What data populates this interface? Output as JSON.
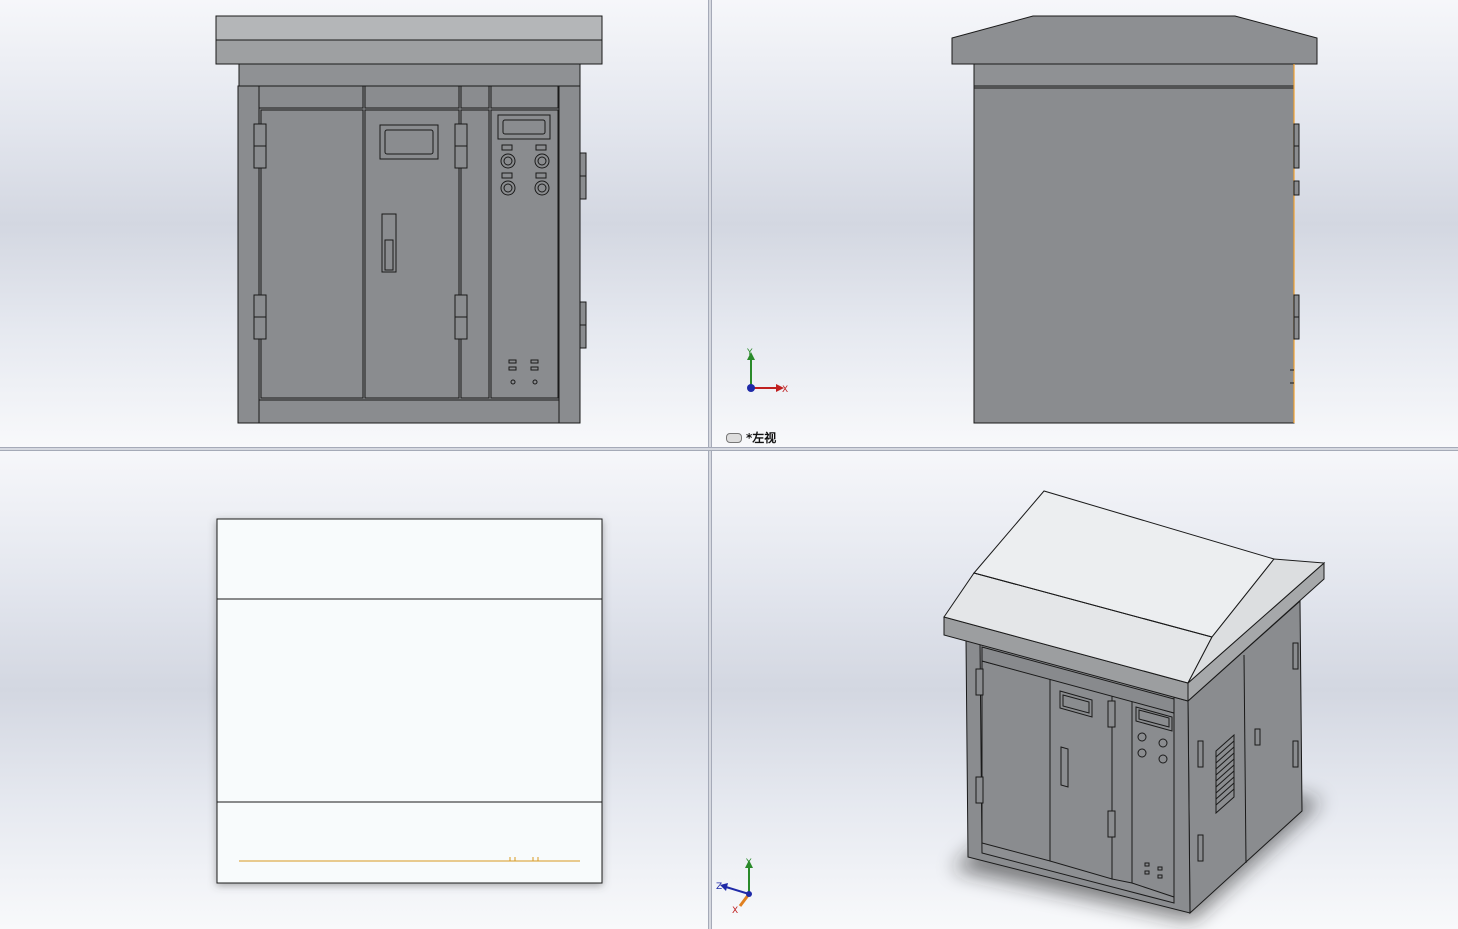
{
  "viewports": {
    "front": {
      "name": "front-view"
    },
    "left": {
      "name": "left-view",
      "label": "*左视"
    },
    "top": {
      "name": "top-view"
    },
    "iso": {
      "name": "isometric-view"
    }
  },
  "triad_left": {
    "y": "Y",
    "x": "X"
  },
  "triad_iso": {
    "y": "Y",
    "z": "Z",
    "x": "X"
  },
  "colors": {
    "body": "#8a8c8f",
    "roof": "#b4b6b8",
    "edge": "#1a1a1a",
    "highlight_edge": "#f0a030",
    "top_view_fill": "#f8fbfc"
  }
}
